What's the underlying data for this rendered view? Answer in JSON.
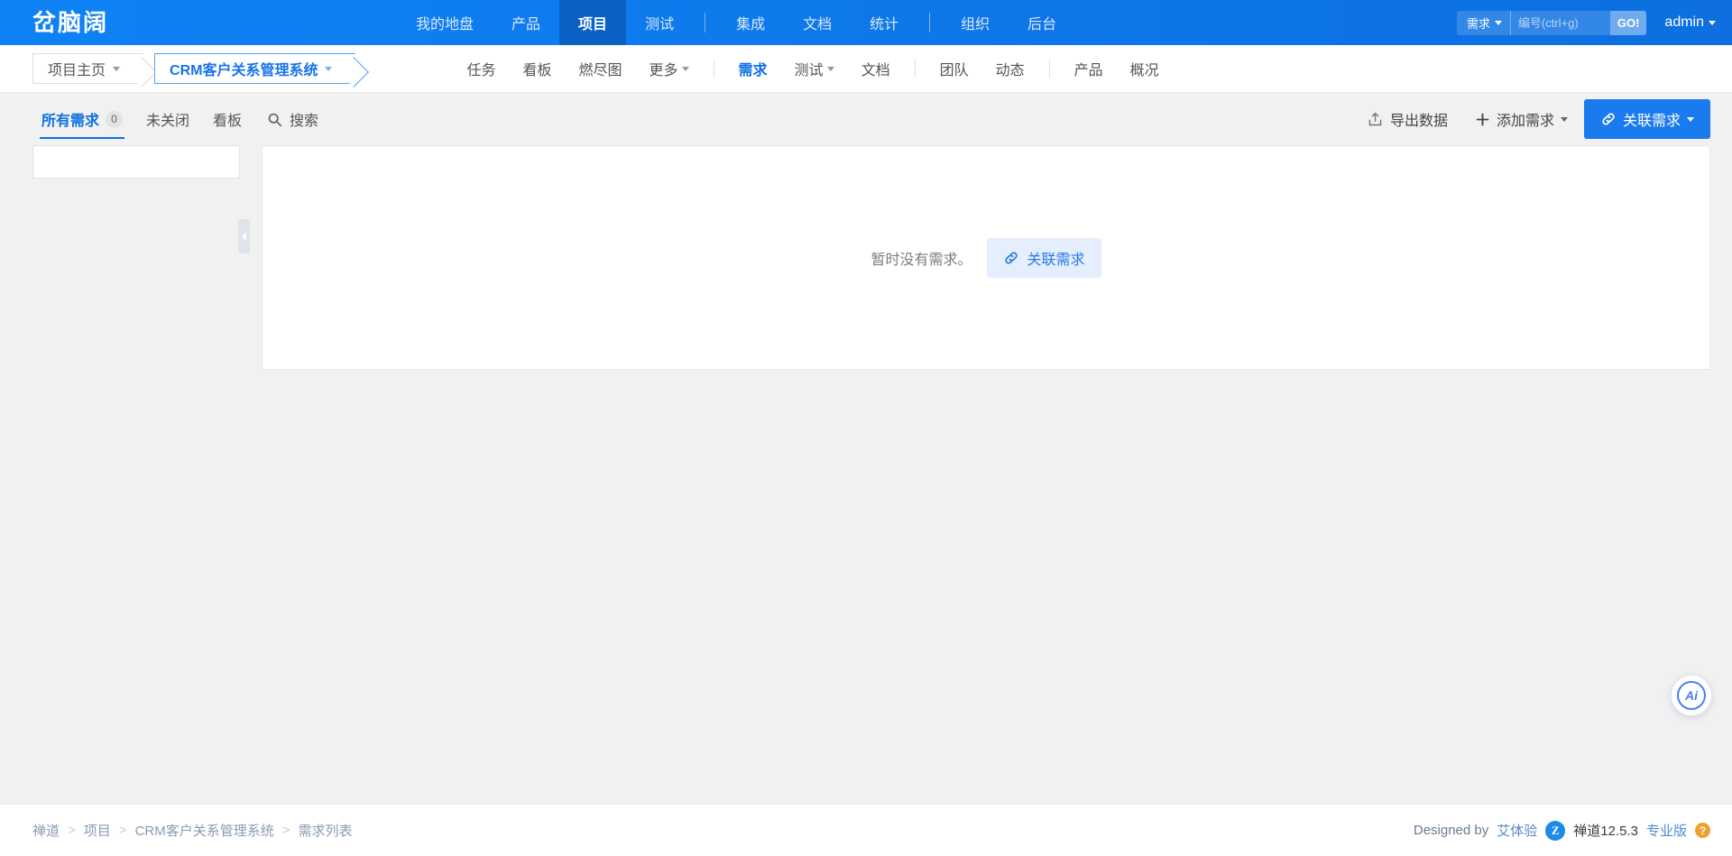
{
  "header": {
    "logo": "岔脑阔",
    "nav": [
      {
        "label": "我的地盘",
        "active": false,
        "sep_after": false
      },
      {
        "label": "产品",
        "active": false,
        "sep_after": false
      },
      {
        "label": "项目",
        "active": true,
        "sep_after": false
      },
      {
        "label": "测试",
        "active": false,
        "sep_after": true
      },
      {
        "label": "集成",
        "active": false,
        "sep_after": false
      },
      {
        "label": "文档",
        "active": false,
        "sep_after": false
      },
      {
        "label": "统计",
        "active": false,
        "sep_after": true
      },
      {
        "label": "组织",
        "active": false,
        "sep_after": false
      },
      {
        "label": "后台",
        "active": false,
        "sep_after": false
      }
    ],
    "search": {
      "type_label": "需求",
      "placeholder": "编号(ctrl+g)",
      "go_label": "GO!",
      "value": ""
    },
    "user": "admin"
  },
  "subbar": {
    "breadcrumb": [
      {
        "label": "项目主页",
        "active": false
      },
      {
        "label": "CRM客户关系管理系统",
        "active": true
      }
    ],
    "nav": [
      {
        "label": "任务",
        "active": false,
        "caret": false,
        "sep_after": false
      },
      {
        "label": "看板",
        "active": false,
        "caret": false,
        "sep_after": false
      },
      {
        "label": "燃尽图",
        "active": false,
        "caret": false,
        "sep_after": false
      },
      {
        "label": "更多",
        "active": false,
        "caret": true,
        "sep_after": true
      },
      {
        "label": "需求",
        "active": true,
        "caret": false,
        "sep_after": false
      },
      {
        "label": "测试",
        "active": false,
        "caret": true,
        "sep_after": false
      },
      {
        "label": "文档",
        "active": false,
        "caret": false,
        "sep_after": true
      },
      {
        "label": "团队",
        "active": false,
        "caret": false,
        "sep_after": false
      },
      {
        "label": "动态",
        "active": false,
        "caret": false,
        "sep_after": true
      },
      {
        "label": "产品",
        "active": false,
        "caret": false,
        "sep_after": false
      },
      {
        "label": "概况",
        "active": false,
        "caret": false,
        "sep_after": false
      }
    ]
  },
  "toolbar": {
    "tabs": [
      {
        "label": "所有需求",
        "badge": "0",
        "active": true
      },
      {
        "label": "未关闭",
        "badge": "",
        "active": false
      },
      {
        "label": "看板",
        "badge": "",
        "active": false
      }
    ],
    "search_tab": "搜索",
    "export_label": "导出数据",
    "add_label": "添加需求",
    "link_label": "关联需求"
  },
  "main": {
    "empty_text": "暂时没有需求。",
    "empty_button": "关联需求"
  },
  "float": {
    "ai_label": "Ai"
  },
  "footer": {
    "breadcrumb": [
      "禅道",
      "项目",
      "CRM客户关系管理系统",
      "需求列表"
    ],
    "separator": ">",
    "designed_by": "Designed by",
    "designer": "艾体验",
    "product_mark": "Z",
    "product_name": "禅道12.5.3",
    "edition": "专业版",
    "help": "?"
  },
  "colors": {
    "brand_blue": "#0f7ef0",
    "active_nav": "#0a62c4",
    "link_blue": "#1a73e8",
    "page_bg": "#f1f1f1"
  }
}
